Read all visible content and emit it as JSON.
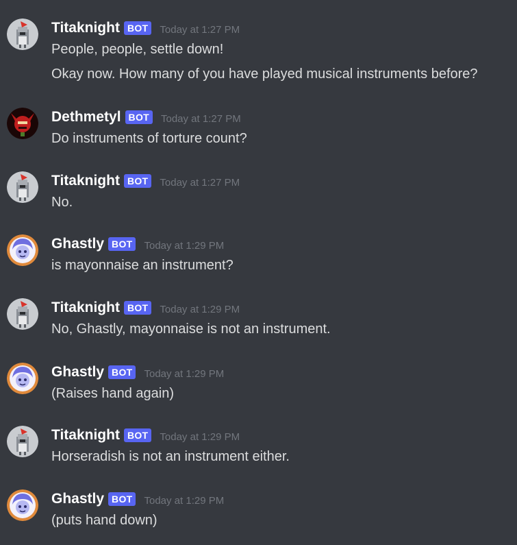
{
  "colors": {
    "background": "#36393f",
    "bot_tag": "#5865f2",
    "timestamp": "#72767d",
    "text": "#dcddde",
    "username": "#ffffff"
  },
  "messages": [
    {
      "author": "Titaknight",
      "avatar": "titaknight-avatar-icon",
      "tag": "BOT",
      "time": "Today at 1:27 PM",
      "lines": [
        "People, people, settle down!",
        "Okay now. How many of you have played musical instruments before?"
      ]
    },
    {
      "author": "Dethmetyl",
      "avatar": "dethmetyl-avatar-icon",
      "tag": "BOT",
      "time": "Today at 1:27 PM",
      "lines": [
        "Do instruments of torture count?"
      ]
    },
    {
      "author": "Titaknight",
      "avatar": "titaknight-avatar-icon",
      "tag": "BOT",
      "time": "Today at 1:27 PM",
      "lines": [
        "No."
      ]
    },
    {
      "author": "Ghastly",
      "avatar": "ghastly-avatar-icon",
      "tag": "BOT",
      "time": "Today at 1:29 PM",
      "lines": [
        "is mayonnaise an instrument?"
      ]
    },
    {
      "author": "Titaknight",
      "avatar": "titaknight-avatar-icon",
      "tag": "BOT",
      "time": "Today at 1:29 PM",
      "lines": [
        "No, Ghastly, mayonnaise is not an instrument."
      ]
    },
    {
      "author": "Ghastly",
      "avatar": "ghastly-avatar-icon",
      "tag": "BOT",
      "time": "Today at 1:29 PM",
      "lines": [
        "(Raises hand again)"
      ]
    },
    {
      "author": "Titaknight",
      "avatar": "titaknight-avatar-icon",
      "tag": "BOT",
      "time": "Today at 1:29 PM",
      "lines": [
        "Horseradish is not an instrument either."
      ]
    },
    {
      "author": "Ghastly",
      "avatar": "ghastly-avatar-icon",
      "tag": "BOT",
      "time": "Today at 1:29 PM",
      "lines": [
        "(puts hand down)"
      ]
    }
  ]
}
